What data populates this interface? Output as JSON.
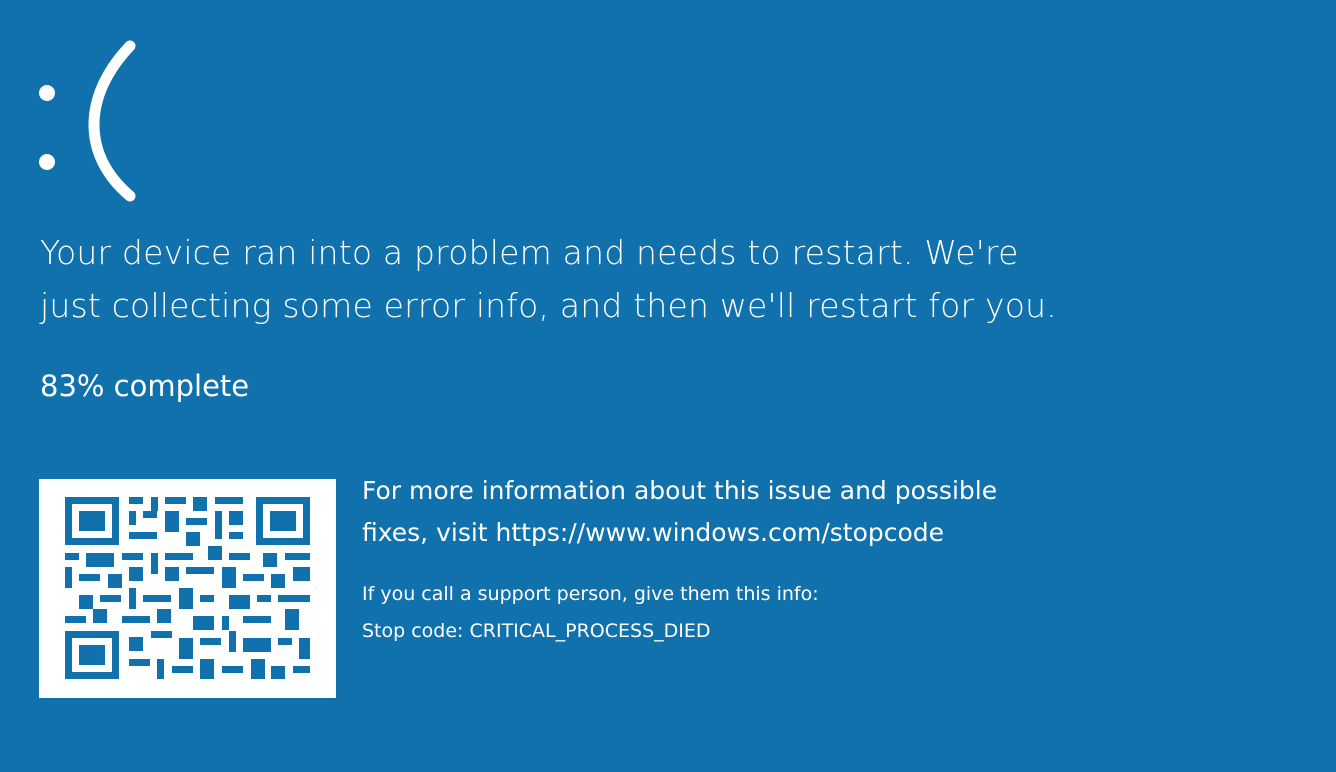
{
  "colors": {
    "background": "#1071ad",
    "foreground": "#ffffff"
  },
  "face": {
    "icon": "sad-face-icon",
    "text": ":("
  },
  "message": {
    "line1": "Your device ran into a problem and needs to restart. We're",
    "line2": "just collecting some error info, and then we'll restart for you."
  },
  "progress": {
    "percent": 83,
    "text": "83% complete"
  },
  "qr": {
    "icon": "qr-code-icon"
  },
  "info": {
    "line1": "For more information about this issue and possible",
    "line2": "fixes, visit https://www.windows.com/stopcode"
  },
  "support": {
    "prompt": "If you call a support person, give them this info:",
    "stop_code": "Stop code: CRITICAL_PROCESS_DIED"
  }
}
